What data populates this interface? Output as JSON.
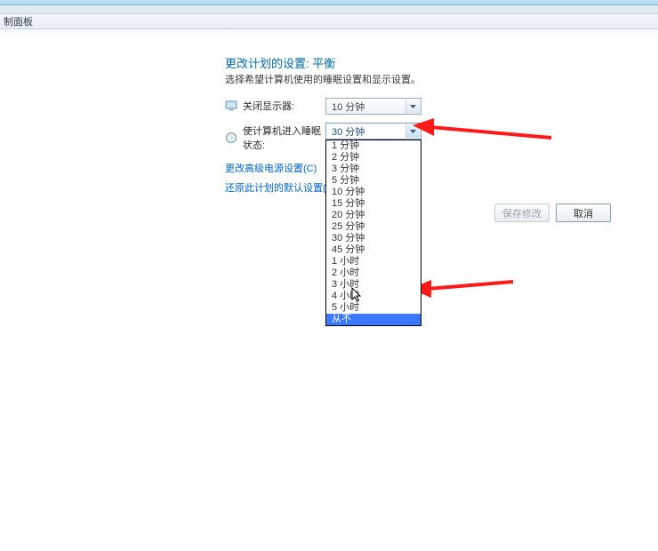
{
  "window": {
    "breadcrumb_tail": "制面板"
  },
  "page": {
    "heading": "更改计划的设置: 平衡",
    "subtitle": "选择希望计算机使用的睡眠设置和显示设置。",
    "display_label": "关闭显示器:",
    "sleep_label": "使计算机进入睡眠状态:",
    "display_value": "10 分钟",
    "sleep_value": "30 分钟",
    "link_advanced": "更改高级电源设置(C)",
    "link_restore": "还原此计划的默认设置(R)",
    "btn_save": "保存修改",
    "btn_cancel": "取消"
  },
  "dropdown": {
    "options": [
      "1 分钟",
      "2 分钟",
      "3 分钟",
      "5 分钟",
      "10 分钟",
      "15 分钟",
      "20 分钟",
      "25 分钟",
      "30 分钟",
      "45 分钟",
      "1 小时",
      "2 小时",
      "3 小时",
      "4 小时",
      "5 小时",
      "从不"
    ],
    "highlighted_index": 15
  }
}
